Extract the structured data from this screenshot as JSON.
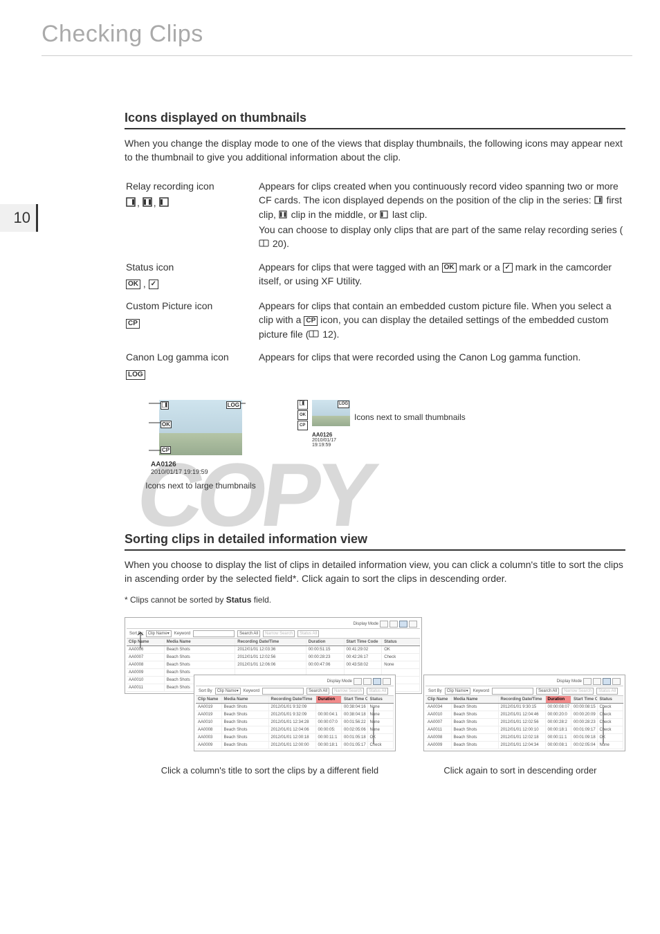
{
  "page_number": "10",
  "page_title": "Checking Clips",
  "section1": {
    "heading": "Icons displayed on thumbnails",
    "intro": "When you change the display mode to one of the views that display thumbnails, the following icons may appear next to the thumbnail to give you additional information about the clip.",
    "rows": [
      {
        "label": "Relay recording icon",
        "icons_text": [
          ",",
          ","
        ],
        "desc_pre": "Appears for clips created when you continuously record video spanning two or more CF cards. The icon displayed depends on the position of the clip in the series: ",
        "first": " first clip, ",
        "middle": " clip in the middle, or ",
        "last": " last clip.",
        "desc_post": "You can choose to display only clips that are part of the same relay recording series (",
        "ref": " 20)."
      },
      {
        "label": "Status icon",
        "icon_label_ok": "OK",
        "desc_a": "Appears for clips that were tagged with an ",
        "desc_b": " mark or a ",
        "desc_c": " mark in the camcorder itself, or using XF Utility."
      },
      {
        "label": "Custom Picture icon",
        "icon_label": "CP",
        "desc_a": "Appears for clips that contain an embedded custom picture file. When you select a clip with a ",
        "desc_b": " icon, you can display the detailed settings of the embedded custom picture file (",
        "ref": " 12)."
      },
      {
        "label": "Canon Log gamma icon",
        "icon_label": "LOG",
        "desc": "Appears for clips that were recorded using the Canon Log gamma function."
      }
    ],
    "thumb_large_title": "AA0126",
    "thumb_large_date": "2010/01/17 19:19:59",
    "thumb_large_caption": "Icons next to large thumbnails",
    "thumb_small_title": "AA0126",
    "thumb_small_date_l1": "2010/01/17",
    "thumb_small_date_l2": "19:19:59",
    "thumb_small_caption": "Icons next to small thumbnails"
  },
  "section2": {
    "heading": "Sorting clips in detailed information view",
    "intro": "When you choose to display the list of clips in detailed information view, you can click a column's title to sort the clips in ascending order by the selected field*. Click again to sort the clips in descending order.",
    "footnote_pre": "* Clips cannot be sorted by ",
    "footnote_bold": "Status",
    "footnote_post": " field.",
    "display_mode_label": "Display Mode",
    "search_label": "Sort By",
    "search_field": "Clip Name",
    "keyword_label": "Keyword",
    "search_btn": "Search All",
    "narrow_btn": "Narrow Search",
    "status_btn": "Status All",
    "columns": [
      "Clip Name",
      "Media Name",
      "Recording Date/Time",
      "Duration",
      "Start Time Code",
      "Status"
    ],
    "table1_rows": [
      [
        "AA0006",
        "Beach Shots",
        "2012/01/01 12:03:36",
        "00:00:51:15",
        "00:41:29:02",
        "OK"
      ],
      [
        "AA0007",
        "Beach Shots",
        "2012/01/01 12:02:56",
        "00:00:28:23",
        "00:42:26:17",
        "Check"
      ],
      [
        "AA0008",
        "Beach Shots",
        "2012/01/01 12:06:06",
        "00:00:47:06",
        "00:43:58:02",
        "None"
      ],
      [
        "AA0009",
        "Beach Shots",
        "",
        "",
        "",
        ""
      ],
      [
        "AA0010",
        "Beach Shots",
        "",
        "",
        "",
        ""
      ],
      [
        "AA0011",
        "Beach Shots",
        "",
        "",
        "",
        ""
      ]
    ],
    "table2_rows": [
      [
        "AA0019",
        "Beach Shots",
        "2012/01/01 9:32:09",
        "",
        "00:38:04:16",
        "None"
      ],
      [
        "AA0019",
        "Beach Shots",
        "2012/01/01 9:32:09",
        "00:00:04:1",
        "00:38:04:18",
        "None"
      ],
      [
        "AA0010",
        "Beach Shots",
        "2012/01/01 12:34:28",
        "00:00:07:0",
        "00:01:56:22",
        "None"
      ],
      [
        "AA0008",
        "Beach Shots",
        "2012/01/01 12:04:06",
        "00:00:05:",
        "00:02:05:06",
        "None"
      ],
      [
        "AA0003",
        "Beach Shots",
        "2012/01/01 12:00:18",
        "00:00:11:1",
        "00:01:05:18",
        "OK"
      ],
      [
        "AA0009",
        "Beach Shots",
        "2012/01/01 12:00:00",
        "00:00:18:1",
        "00:01:05:17",
        "Check"
      ]
    ],
    "table3_rows": [
      [
        "AA0034",
        "Beach Shots",
        "2012/01/01 9:30:15",
        "00:00:08:07",
        "00:00:08:15",
        "Check"
      ],
      [
        "AA0010",
        "Beach Shots",
        "2012/01/01 12:04:46",
        "00:00:20:0",
        "00:00:20:09",
        "Check"
      ],
      [
        "AA0007",
        "Beach Shots",
        "2012/01/01 12:02:56",
        "00:00:28:2",
        "00:00:28:23",
        "Check"
      ],
      [
        "AA0011",
        "Beach Shots",
        "2012/01/01 12:00:10",
        "00:00:18:1",
        "00:01:09:17",
        "Check"
      ],
      [
        "AA0008",
        "Beach Shots",
        "2012/01/01 12:02:18",
        "00:00:11:1",
        "00:01:09:18",
        "OK"
      ],
      [
        "AA0009",
        "Beach Shots",
        "2012/01/01 12:04:34",
        "00:00:08:1",
        "00:02:05:04",
        "None"
      ]
    ],
    "caption_left": "Click a column's title to sort the clips by a different field",
    "caption_right": "Click again to sort in descending order"
  },
  "watermark_text": "COPY"
}
